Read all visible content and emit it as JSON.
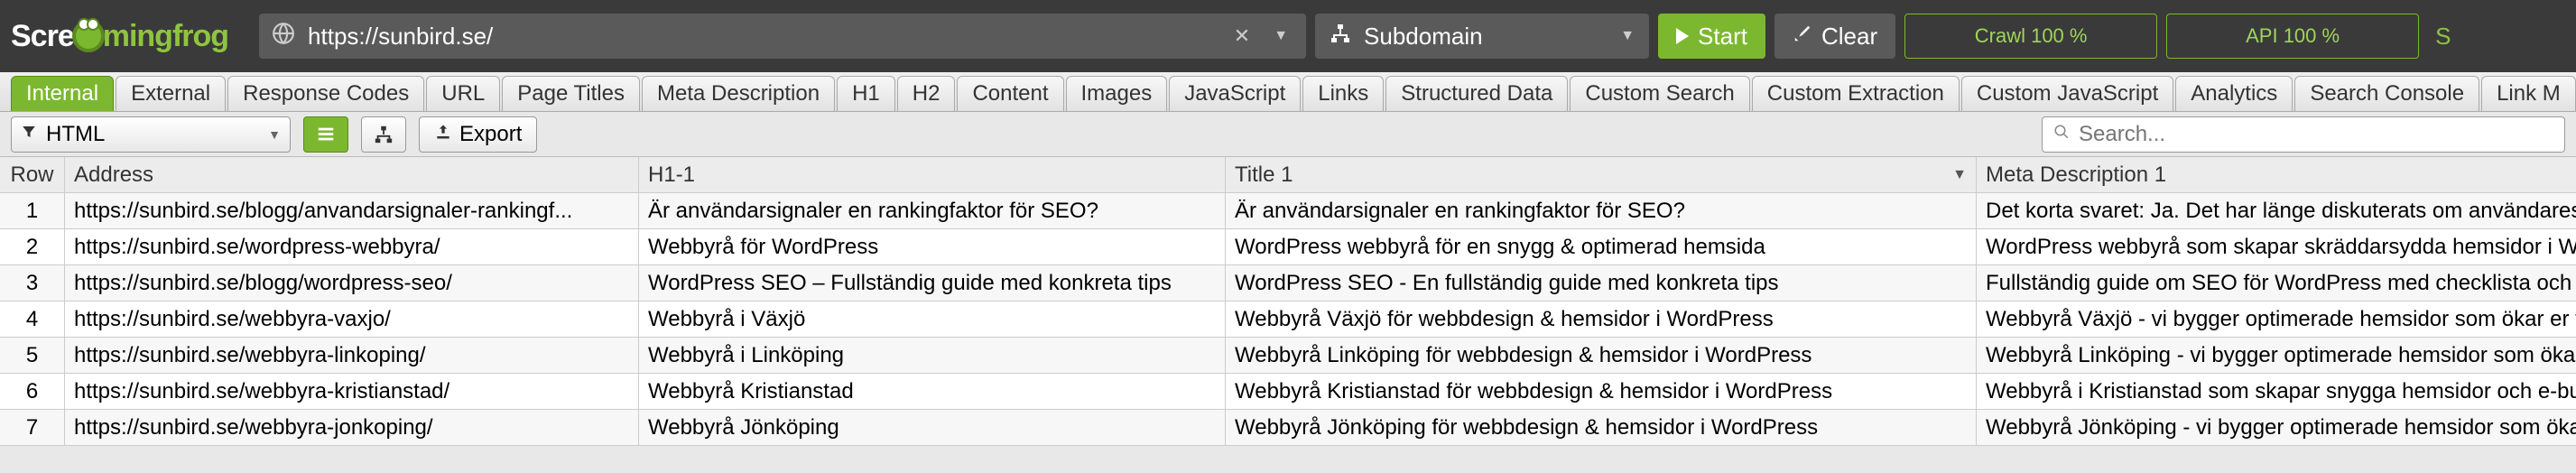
{
  "topbar": {
    "logo_pre": "Scre",
    "logo_mid": "ming",
    "logo_post": "frog",
    "url": "https://sunbird.se/",
    "mode": "Subdomain",
    "start": "Start",
    "clear": "Clear",
    "crawl_status": "Crawl 100 %",
    "api_status": "API 100 %",
    "trailing": "S"
  },
  "tabs": [
    "Internal",
    "External",
    "Response Codes",
    "URL",
    "Page Titles",
    "Meta Description",
    "H1",
    "H2",
    "Content",
    "Images",
    "JavaScript",
    "Links",
    "Structured Data",
    "Custom Search",
    "Custom Extraction",
    "Custom JavaScript",
    "Analytics",
    "Search Console",
    "Link M"
  ],
  "active_tab_index": 0,
  "controls": {
    "filter": "HTML",
    "export": "Export",
    "search_placeholder": "Search..."
  },
  "columns": {
    "row": "Row",
    "address": "Address",
    "h1": "H1-1",
    "title": "Title 1",
    "meta": "Meta Description 1"
  },
  "rows": [
    {
      "n": "1",
      "address": "https://sunbird.se/blogg/anvandarsignaler-rankingf...",
      "h1": "Är användarsignaler en rankingfaktor för SEO?",
      "title": "Är användarsignaler en rankingfaktor för SEO?",
      "meta": "Det korta svaret: Ja. Det har länge diskuterats om användares interaktioner m"
    },
    {
      "n": "2",
      "address": "https://sunbird.se/wordpress-webbyra/",
      "h1": "Webbyrå för WordPress",
      "title": "WordPress webbyrå för en snygg & optimerad hemsida",
      "meta": "WordPress webbyrå som skapar skräddarsydda hemsidor i WordPress som s"
    },
    {
      "n": "3",
      "address": "https://sunbird.se/blogg/wordpress-seo/",
      "h1": "WordPress SEO – Fullständig guide med konkreta tips",
      "title": "WordPress SEO - En fullständig guide med konkreta tips",
      "meta": "Fullständig guide om SEO för WordPress med checklista och konkreta tips f"
    },
    {
      "n": "4",
      "address": "https://sunbird.se/webbyra-vaxjo/",
      "h1": "Webbyrå i Växjö",
      "title": "Webbyrå Växjö för webbdesign & hemsidor i WordPress",
      "meta": "Webbyrå Växjö - vi bygger optimerade hemsidor som ökar er försäljning » Bör"
    },
    {
      "n": "5",
      "address": "https://sunbird.se/webbyra-linkoping/",
      "h1": "Webbyrå i Linköping",
      "title": "Webbyrå Linköping för webbdesign & hemsidor i WordPress",
      "meta": "Webbyrå Linköping - vi bygger optimerade hemsidor som ökar er försäljning »"
    },
    {
      "n": "6",
      "address": "https://sunbird.se/webbyra-kristianstad/",
      "h1": "Webbyrå Kristianstad",
      "title": "Webbyrå Kristianstad för webbdesign & hemsidor i WordPress",
      "meta": "Webbyrå i Kristianstad som skapar snygga hemsidor och e-butiker som säljer"
    },
    {
      "n": "7",
      "address": "https://sunbird.se/webbyra-jonkoping/",
      "h1": "Webbyrå Jönköping",
      "title": "Webbyrå Jönköping för webbdesign & hemsidor i WordPress",
      "meta": "Webbyrå Jönköping - vi bygger optimerade hemsidor som ökar er försäljning »"
    }
  ]
}
